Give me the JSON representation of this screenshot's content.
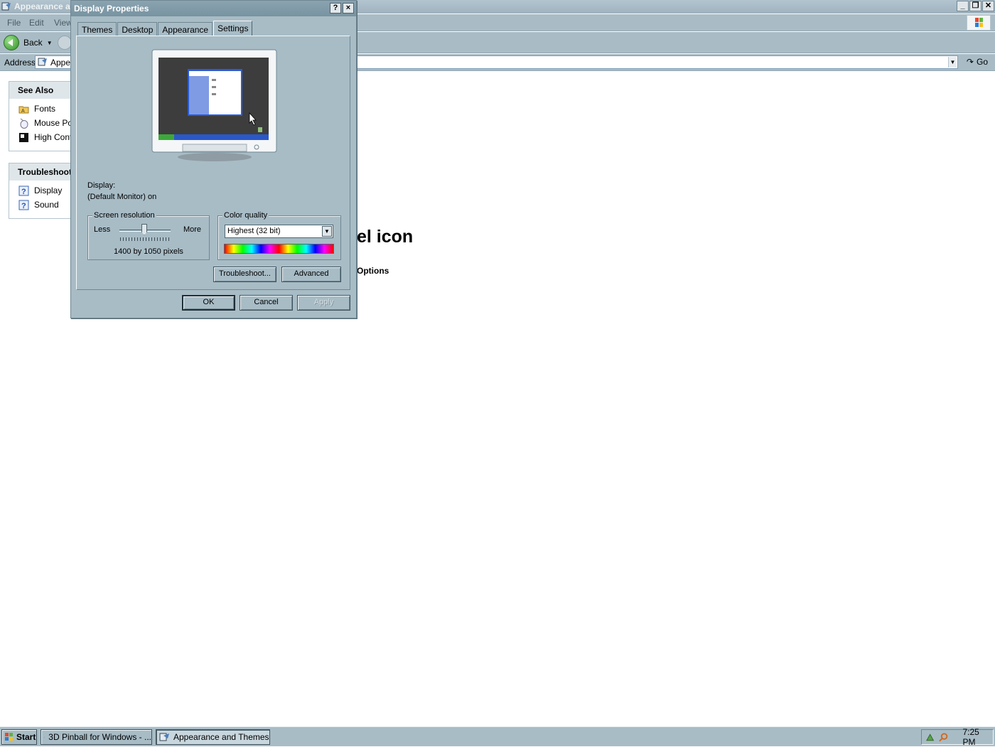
{
  "explorer": {
    "title": "Appearance a",
    "menu": [
      "File",
      "Edit",
      "View"
    ],
    "back_label": "Back",
    "address_label": "Address",
    "address_value": "Appe",
    "go_label": "Go",
    "see_also": {
      "title": "See Also",
      "items": [
        "Fonts",
        "Mouse Poi",
        "High Contr"
      ]
    },
    "troubleshooters": {
      "title": "Troubleshoot",
      "items": [
        "Display",
        "Sound"
      ]
    },
    "heading_fragment": "el icon",
    "link_fragment": "Options"
  },
  "dialog": {
    "title": "Display Properties",
    "help_label": "?",
    "close_label": "×",
    "tabs": [
      "Themes",
      "Desktop",
      "Appearance",
      "Settings"
    ],
    "active_tab": "Settings",
    "display_label": "Display:",
    "display_value": "(Default Monitor) on",
    "screen_resolution": {
      "title": "Screen resolution",
      "less": "Less",
      "more": "More",
      "value_text": "1400 by 1050 pixels"
    },
    "color_quality": {
      "title": "Color quality",
      "selected": "Highest (32 bit)"
    },
    "troubleshoot_button": "Troubleshoot...",
    "advanced_button": "Advanced",
    "ok_button": "OK",
    "cancel_button": "Cancel",
    "apply_button": "Apply"
  },
  "taskbar": {
    "start_label": "Start",
    "tasks": [
      "3D Pinball for Windows - ...",
      "Appearance and Themes"
    ],
    "clock": "7:25 PM"
  }
}
